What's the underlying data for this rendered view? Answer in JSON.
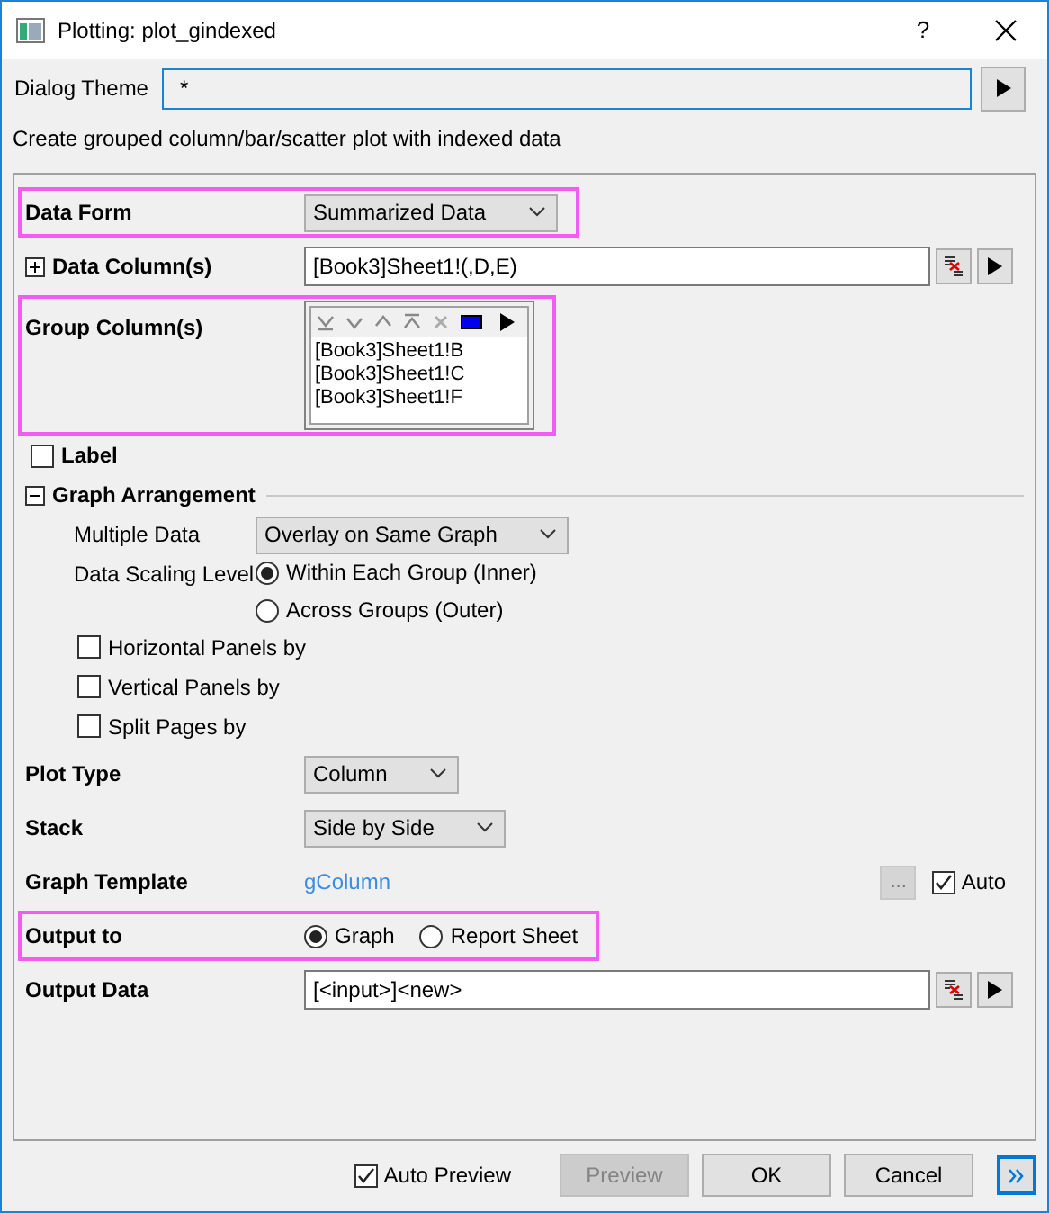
{
  "window": {
    "title": "Plotting: plot_gindexed",
    "help": "?"
  },
  "dialog_theme": {
    "label": "Dialog Theme",
    "value": "*"
  },
  "description": "Create grouped column/bar/scatter plot with indexed data",
  "rows": [
    {
      "kind": "dropdown",
      "label": "Data Form",
      "value": "Summarized Data",
      "highlighted": true
    },
    {
      "kind": "range",
      "label": "Data Column(s)",
      "value": "[Book3]Sheet1!(,D,E)",
      "expanded": false,
      "highlighted": false
    },
    {
      "kind": "list",
      "label": "Group Column(s)",
      "items": [
        "[Book3]Sheet1!B",
        "[Book3]Sheet1!C",
        "[Book3]Sheet1!F"
      ],
      "highlighted": true
    },
    {
      "kind": "checkbox",
      "label": "Label",
      "checked": false,
      "highlighted": false
    },
    {
      "kind": "section",
      "label": "Graph Arrangement",
      "expanded": true,
      "highlighted": false,
      "children": [
        {
          "kind": "dropdown",
          "label": "Multiple Data",
          "value": "Overlay on Same Graph"
        },
        {
          "kind": "radios",
          "label": "Data Scaling Level",
          "options": [
            {
              "label": "Within Each Group (Inner)",
              "selected": true
            },
            {
              "label": "Across Groups (Outer)",
              "selected": false
            }
          ]
        },
        {
          "kind": "checkbox",
          "label": "Horizontal Panels by",
          "checked": false
        },
        {
          "kind": "checkbox",
          "label": "Vertical Panels by",
          "checked": false
        },
        {
          "kind": "checkbox",
          "label": "Split Pages by",
          "checked": false
        }
      ]
    },
    {
      "kind": "dropdown",
      "label": "Plot Type",
      "value": "Column",
      "highlighted": false
    },
    {
      "kind": "dropdown",
      "label": "Stack",
      "value": "Side by Side",
      "highlighted": false
    },
    {
      "kind": "template",
      "label": "Graph Template",
      "value": "gColumn",
      "button": "...",
      "auto": {
        "label": "Auto",
        "checked": true
      },
      "highlighted": false
    },
    {
      "kind": "radio_row",
      "label": "Output to",
      "options": [
        {
          "label": "Graph",
          "selected": true
        },
        {
          "label": "Report Sheet",
          "selected": false
        }
      ],
      "highlighted": true
    },
    {
      "kind": "range",
      "label": "Output Data",
      "value": "[<input>]<new>",
      "highlighted": false
    }
  ],
  "footer": {
    "auto_preview": {
      "label": "Auto Preview",
      "checked": true
    },
    "buttons": [
      {
        "label": "Preview",
        "disabled": true
      },
      {
        "label": "OK",
        "disabled": false
      },
      {
        "label": "Cancel",
        "disabled": false
      }
    ]
  }
}
